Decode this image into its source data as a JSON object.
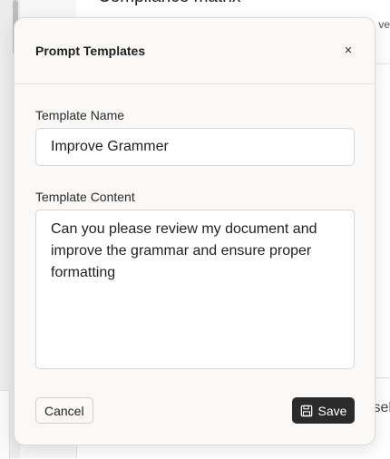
{
  "background": {
    "title": "Compliance matrix",
    "header_right_text": "ver",
    "bottom_right_text": "sel"
  },
  "modal": {
    "title": "Prompt Templates",
    "close_glyph": "×",
    "name_label": "Template Name",
    "name_value": "Improve Grammer",
    "content_label": "Template Content",
    "content_value": "Can you please review my document and improve the grammar and ensure proper formatting ",
    "cancel_label": "Cancel",
    "save_label": "Save",
    "save_icon": "floppy-disk-icon"
  },
  "colors": {
    "save_button_bg": "#2b2b2b",
    "modal_bg": "#faf9f7"
  }
}
